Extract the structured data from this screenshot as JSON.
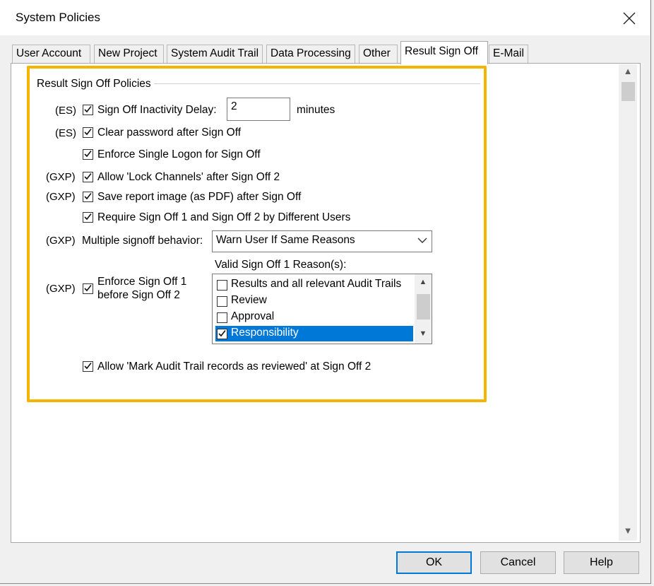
{
  "window": {
    "title": "System Policies"
  },
  "tabs": [
    {
      "label": "User Account"
    },
    {
      "label": "New Project"
    },
    {
      "label": "System Audit Trail"
    },
    {
      "label": "Data Processing"
    },
    {
      "label": "Other"
    },
    {
      "label": "Result Sign Off",
      "active": true
    },
    {
      "label": "E-Mail"
    }
  ],
  "group": {
    "title": "Result Sign Off Policies",
    "rows": [
      {
        "prefix": "(ES)",
        "label": "Sign Off Inactivity Delay:",
        "checked": true
      },
      {
        "prefix": "(ES)",
        "label": "Clear password after Sign Off",
        "checked": true
      },
      {
        "prefix": "",
        "label": "Enforce Single Logon for Sign Off",
        "checked": true
      },
      {
        "prefix": "(GXP)",
        "label": "Allow 'Lock Channels' after Sign Off 2",
        "checked": true
      },
      {
        "prefix": "(GXP)",
        "label": "Save report image (as PDF) after Sign Off",
        "checked": true
      },
      {
        "prefix": "",
        "label": "Require Sign Off 1 and Sign Off 2 by Different Users",
        "checked": true
      }
    ],
    "inactivity": {
      "value": "2",
      "unit": "minutes"
    },
    "multiple": {
      "prefix": "(GXP)",
      "label": "Multiple signoff behavior:",
      "selected": "Warn User If Same Reasons"
    },
    "enforce": {
      "prefix": "(GXP)",
      "line1": "Enforce Sign Off 1",
      "line2": "before Sign Off 2",
      "checked": true
    },
    "reasons": {
      "label": "Valid Sign Off 1 Reason(s):",
      "items": [
        {
          "text": "Results and all relevant Audit Trails",
          "checked": false
        },
        {
          "text": "Review",
          "checked": false
        },
        {
          "text": "Approval",
          "checked": false
        },
        {
          "text": "Responsibility",
          "checked": true,
          "selected": true
        }
      ]
    },
    "mark_audit": {
      "label": "Allow 'Mark Audit Trail records as reviewed' at Sign Off 2",
      "checked": true
    }
  },
  "buttons": {
    "ok": "OK",
    "cancel": "Cancel",
    "help": "Help"
  },
  "colors": {
    "highlight": "#f5b400",
    "selection": "#0078d7"
  },
  "icons": {
    "close": "close-icon",
    "chevron": "chevron-down-icon",
    "check": "check-icon"
  }
}
